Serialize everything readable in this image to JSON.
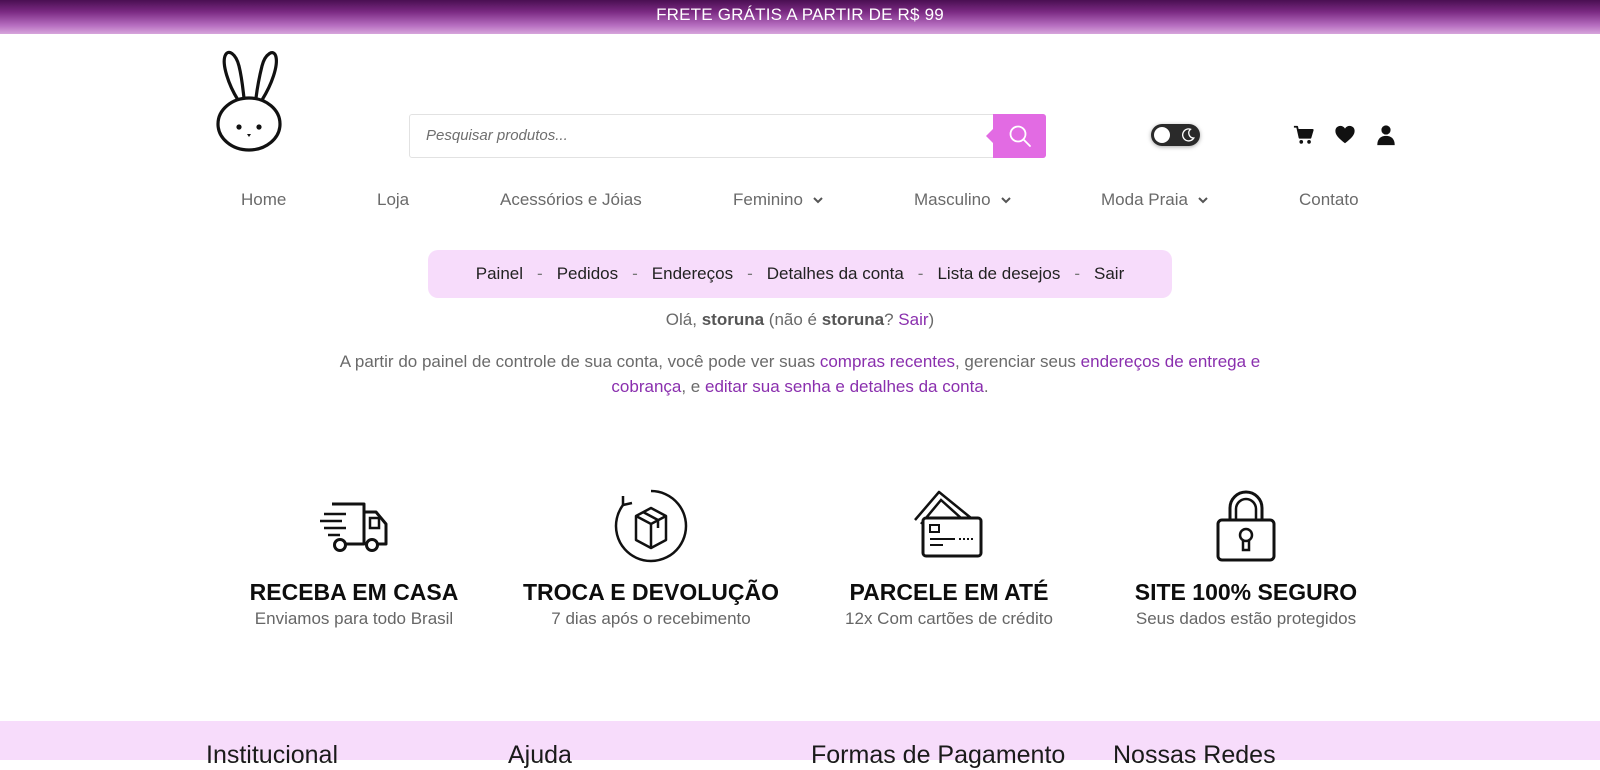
{
  "topbar": {
    "text": "FRETE GRÁTIS A PARTIR DE R$ 99"
  },
  "colors": {
    "accent": "#e26be3",
    "link": "#8a2fae",
    "pill_bg": "#f7dcfb",
    "banner": "#6b1f74"
  },
  "header": {
    "logo": "bunny-logo",
    "search_placeholder": "Pesquisar produtos...",
    "icons": [
      "search-icon",
      "theme-toggle",
      "cart-icon",
      "heart-icon",
      "user-icon"
    ]
  },
  "nav": {
    "home": "Home",
    "loja": "Loja",
    "acessorios": "Acessórios e Jóias",
    "feminino": "Feminino",
    "masculino": "Masculino",
    "moda_praia": "Moda Praia",
    "contato": "Contato"
  },
  "account_nav": {
    "painel": "Painel",
    "pedidos": "Pedidos",
    "enderecos": "Endereços",
    "detalhes": "Detalhes da conta",
    "desejos": "Lista de desejos",
    "sair": "Sair",
    "separator": "-"
  },
  "greeting": {
    "hello": "Olá,",
    "user": "storuna",
    "not_you": "(não é",
    "user2": "storuna",
    "question": "?",
    "logout": "Sair",
    "close": ")"
  },
  "intro": {
    "part1": "A partir do painel de controle de sua conta, você pode ver suas",
    "link1": "compras recentes",
    "part2": ", gerenciar seus",
    "link2": "endereços de entrega e cobrança",
    "part3": ", e",
    "link3": "editar sua senha e detalhes da conta",
    "part4": "."
  },
  "features": [
    {
      "icon": "truck-icon",
      "title": "RECEBA EM CASA",
      "text": "Enviamos para todo Brasil"
    },
    {
      "icon": "box-return-icon",
      "title": "TROCA E DEVOLUÇÃO",
      "text": "7 dias após o recebimento"
    },
    {
      "icon": "credit-card-icon",
      "title": "PARCELE EM ATÉ",
      "text": "12x Com cartões de crédito"
    },
    {
      "icon": "padlock-icon",
      "title": "SITE 100% SEGURO",
      "text": "Seus dados estão protegidos"
    }
  ],
  "footer": {
    "institucional": "Institucional",
    "ajuda": "Ajuda",
    "pagamento": "Formas de Pagamento",
    "redes": "Nossas Redes"
  }
}
